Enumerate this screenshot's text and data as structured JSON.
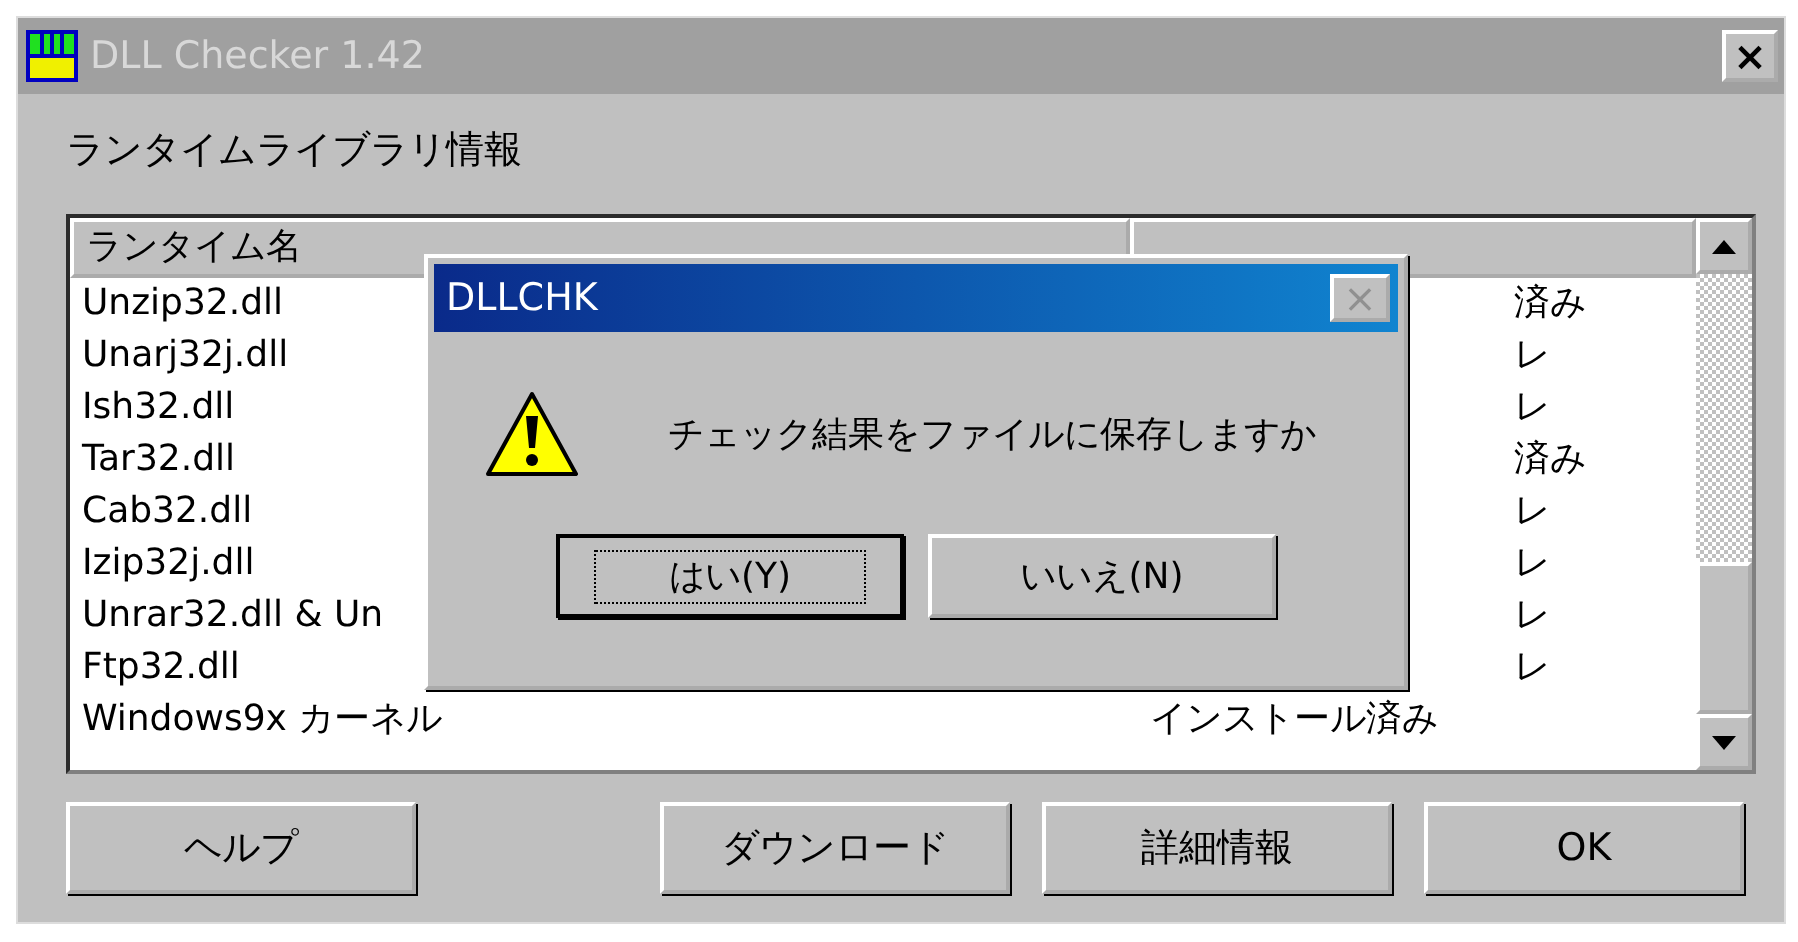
{
  "window": {
    "title": "DLL Checker 1.42",
    "close": "×"
  },
  "section_label": "ランタイムライブラリ情報",
  "table": {
    "columns": [
      {
        "label": "ランタイム名"
      },
      {}
    ],
    "rows": [
      {
        "name": "Unzip32.dll",
        "status": "済み",
        "kind": "covered"
      },
      {
        "name": "Unarj32j.dll",
        "status": "レ",
        "kind": "covered"
      },
      {
        "name": "Ish32.dll",
        "status": "レ",
        "kind": "covered"
      },
      {
        "name": "Tar32.dll",
        "status": "済み",
        "kind": "covered"
      },
      {
        "name": "Cab32.dll",
        "status": "レ",
        "kind": "covered"
      },
      {
        "name": "Izip32j.dll",
        "status": "レ",
        "kind": "covered"
      },
      {
        "name": "Unrar32.dll & Un",
        "status": "レ",
        "kind": "covered"
      },
      {
        "name": "Ftp32.dll",
        "status": "レ",
        "kind": "covered"
      },
      {
        "name": "Windows9x カーネル",
        "status": "インストール済み",
        "kind": "full"
      }
    ]
  },
  "buttons": [
    "ヘルプ",
    "ダウンロード",
    "詳細情報",
    "OK"
  ],
  "dialog": {
    "title": "DLLCHK",
    "close": "×",
    "message": "チェック結果をファイルに保存しますか",
    "buttons": [
      {
        "label": "はい(Y)",
        "focused": true
      },
      {
        "label": "いいえ(N)",
        "focused": false
      }
    ]
  }
}
